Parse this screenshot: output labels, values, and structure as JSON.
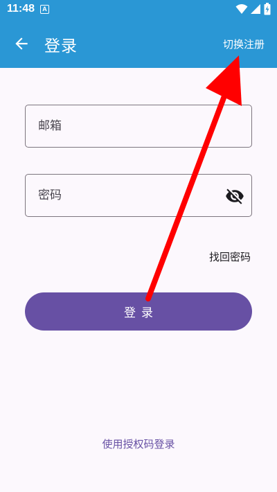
{
  "status_bar": {
    "time": "11:48",
    "notification_icon": "A",
    "icons": [
      "wifi-icon",
      "signal-icon",
      "battery-charging-icon"
    ]
  },
  "app_bar": {
    "back_icon": "arrow-left-icon",
    "title": "登录",
    "switch_label": "切换注册"
  },
  "form": {
    "email_placeholder": "邮箱",
    "email_value": "",
    "password_placeholder": "密码",
    "password_value": "",
    "visibility_icon": "eye-off-icon",
    "forgot_label": "找回密码",
    "login_label": "登录"
  },
  "footer": {
    "auth_code_label": "使用授权码登录"
  },
  "colors": {
    "app_bar": "#2a97d5",
    "primary": "#6750a4",
    "background": "#fcf8fd",
    "annotation": "#ff0000"
  }
}
